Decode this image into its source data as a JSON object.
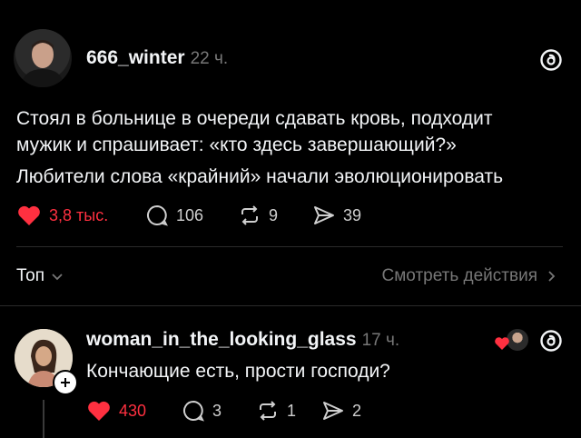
{
  "post": {
    "username": "666_winter",
    "time": "22 ч.",
    "text_lines": [
      "Стоял в больнице в очереди сдавать кровь, подходит",
      "мужик и спрашивает: «кто здесь завершающий?»",
      "Любители слова «крайний» начали эволюционировать"
    ],
    "likes": "3,8 тыс.",
    "comments": "106",
    "reposts": "9",
    "shares": "39"
  },
  "sort_bar": {
    "sort_label": "Топ",
    "activity_link": "Смотреть действия"
  },
  "reply": {
    "username": "woman_in_the_looking_glass",
    "time": "17 ч.",
    "text": "Кончающие есть, прости господи?",
    "likes": "430",
    "comments": "3",
    "reposts": "1",
    "shares": "2"
  },
  "colors": {
    "background": "#000000",
    "text": "#f3f5f7",
    "muted": "#777777",
    "like_red": "#ff3040"
  },
  "icons": [
    "threads-logo-icon",
    "heart-icon",
    "comment-icon",
    "repost-icon",
    "share-icon",
    "chevron-down-icon",
    "chevron-right-icon",
    "follow-plus-icon"
  ]
}
